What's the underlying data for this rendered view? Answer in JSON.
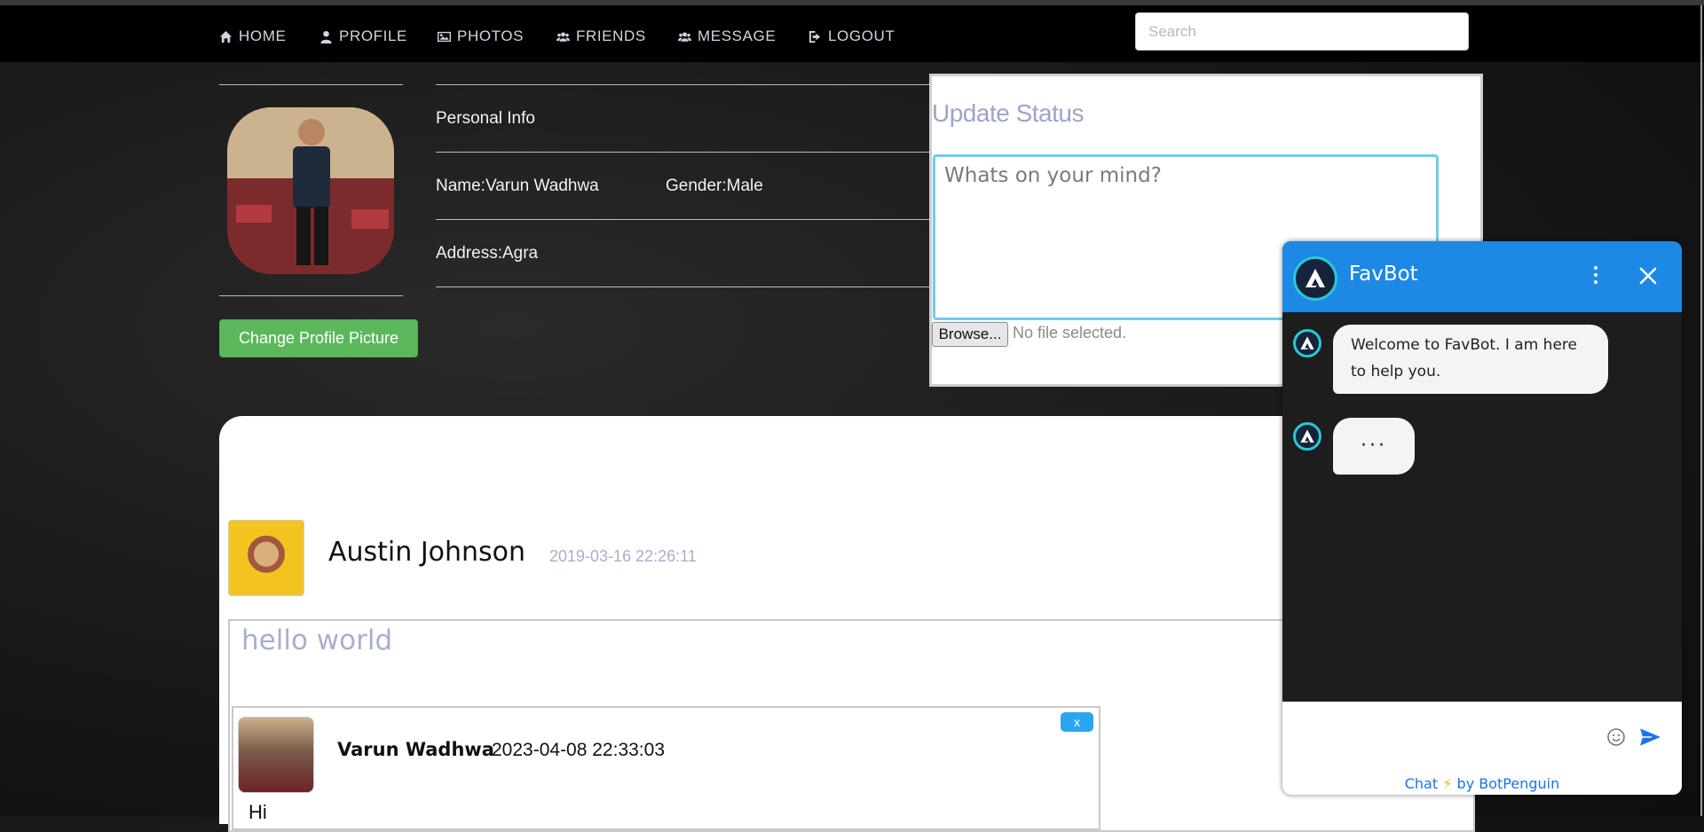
{
  "nav": {
    "items": [
      {
        "label": "HOME",
        "icon": "home-icon"
      },
      {
        "label": "PROFILE",
        "icon": "user-icon"
      },
      {
        "label": "PHOTOS",
        "icon": "image-icon"
      },
      {
        "label": "FRIENDS",
        "icon": "users-icon"
      },
      {
        "label": "MESSAGE",
        "icon": "users-icon"
      },
      {
        "label": "LOGOUT",
        "icon": "sign-out-icon"
      }
    ],
    "search_placeholder": "Search"
  },
  "profile": {
    "change_picture_label": "Change Profile Picture",
    "section_title": "Personal Info",
    "name": "Name:Varun Wadhwa",
    "gender": "Gender:Male",
    "address": "Address:Agra"
  },
  "status": {
    "title": "Update Status",
    "placeholder": "Whats on your mind?",
    "browse_label": "Browse...",
    "file_status": "No file selected."
  },
  "post": {
    "author": "Austin Johnson",
    "timestamp": "2019-03-16 22:26:11",
    "text": "hello world",
    "comment": {
      "author": "Varun Wadhwa",
      "timestamp": "2023-04-08 22:33:03",
      "delete_label": "x",
      "text": "Hi"
    }
  },
  "chatbot": {
    "title": "FavBot",
    "messages": [
      {
        "text": "Welcome to FavBot. I am here to help you."
      },
      {
        "text": "···"
      }
    ],
    "credit_prefix": "Chat",
    "credit_suffix": "by BotPenguin",
    "colors": {
      "header": "#1e88e5",
      "accent": "#2bc7d4"
    }
  }
}
